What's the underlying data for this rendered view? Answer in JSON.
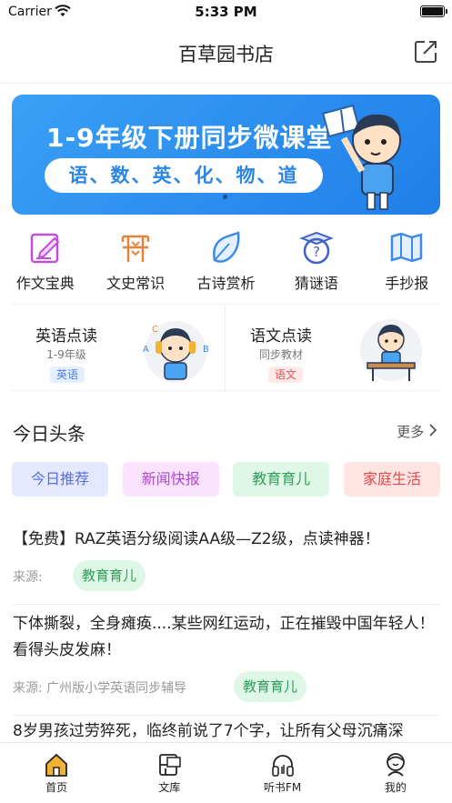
{
  "status": {
    "carrier": "Carrier",
    "time": "5:33 PM"
  },
  "nav": {
    "title": "百草园书店"
  },
  "banner": {
    "headline": "1-9年级下册同步微课堂",
    "subjects": "语、数、英、化、物、道"
  },
  "categories": [
    {
      "label": "作文宝典",
      "icon": "edit-icon",
      "color": "#c24fd8"
    },
    {
      "label": "文史常识",
      "icon": "history-icon",
      "color": "#e8843a"
    },
    {
      "label": "古诗赏析",
      "icon": "leaf-icon",
      "color": "#3f8ae8"
    },
    {
      "label": "猜谜语",
      "icon": "riddle-icon",
      "color": "#3f62c8"
    },
    {
      "label": "手抄报",
      "icon": "map-icon",
      "color": "#3f8ae8"
    }
  ],
  "read_cards": [
    {
      "title": "英语点读",
      "sub": "1-9年级",
      "tag": "英语"
    },
    {
      "title": "语文点读",
      "sub": "同步教材",
      "tag": "语文"
    }
  ],
  "headlines": {
    "title": "今日头条",
    "more": "更多",
    "tabs": [
      "今日推荐",
      "新闻快报",
      "教育育儿",
      "家庭生活"
    ]
  },
  "news": [
    {
      "text": "【免费】RAZ英语分级阅读AA级—Z2级，点读神器！",
      "source": "来源:",
      "badge": "教育育儿"
    },
    {
      "text": "下体撕裂，全身瘫痪....某些网红运动，正在摧毁中国年轻人！看得头皮发麻！",
      "source": "来源:  广州版小学英语同步辅导",
      "badge": "教育育儿"
    },
    {
      "text": "8岁男孩过劳猝死，临终前说了7个字，让所有父母沉痛深"
    }
  ],
  "tab_bar": [
    {
      "label": "首页",
      "icon": "home-icon",
      "active": true
    },
    {
      "label": "文库",
      "icon": "library-icon"
    },
    {
      "label": "听书FM",
      "icon": "headphones-icon"
    },
    {
      "label": "我的",
      "icon": "profile-icon"
    }
  ],
  "colors": {
    "accent": "#2b86e6",
    "banner_top": "#3aa0f5",
    "banner_bottom": "#1f7fe8",
    "home_active": "#f2b233"
  }
}
